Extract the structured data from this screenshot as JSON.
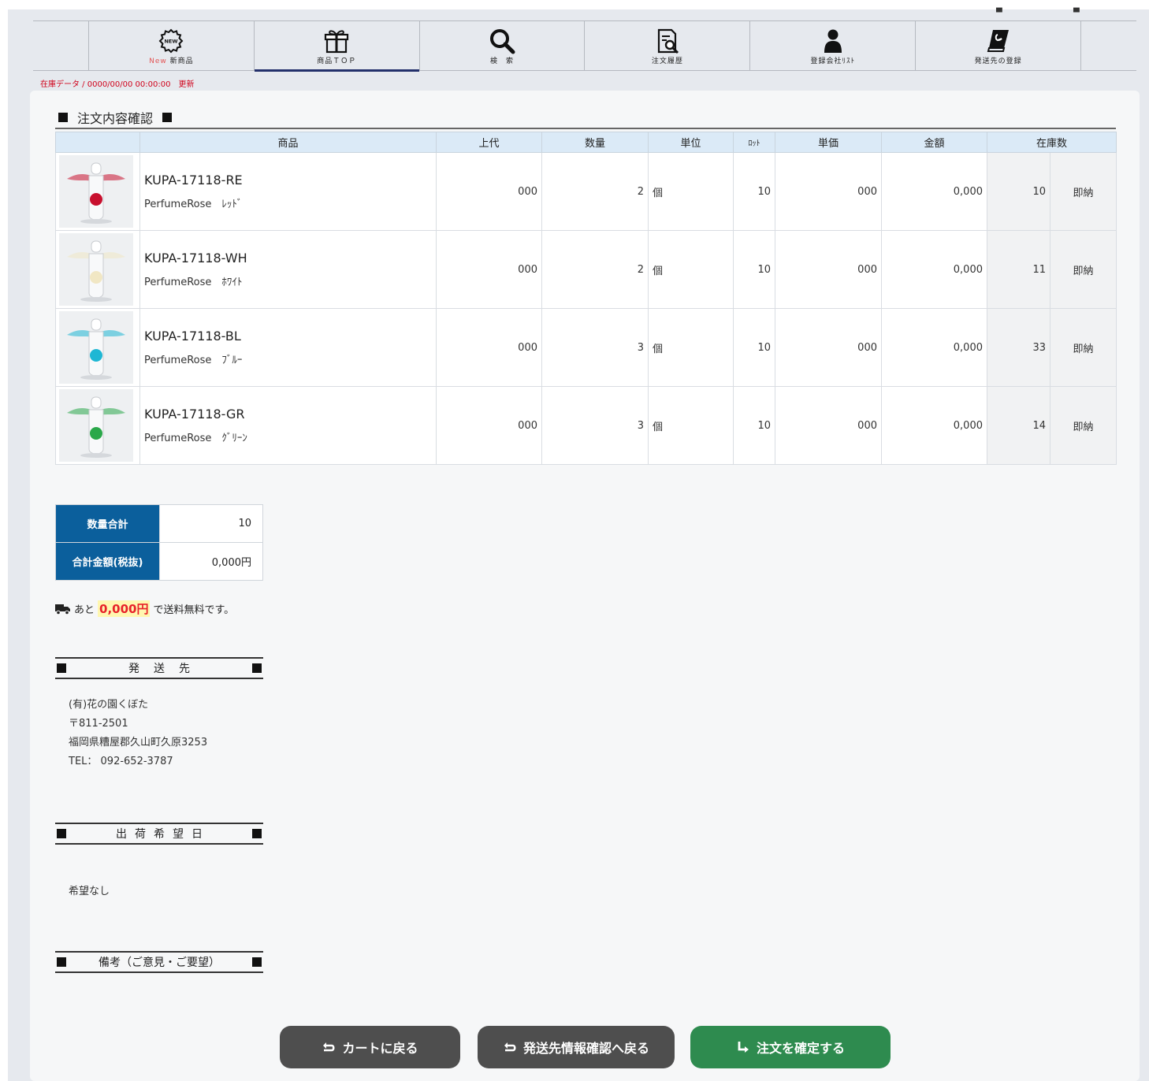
{
  "nav": {
    "items": [
      {
        "label_prefix": "New ",
        "label": "新商品",
        "icon": "new-badge-icon"
      },
      {
        "label_prefix": "",
        "label": "商品ＴＯＰ",
        "icon": "gift-icon"
      },
      {
        "label_prefix": "",
        "label": "検　索",
        "icon": "search-icon"
      },
      {
        "label_prefix": "",
        "label": "注文履歴",
        "icon": "order-history-icon"
      },
      {
        "label_prefix": "",
        "label": "登録会社ﾘｽﾄ",
        "icon": "user-icon"
      },
      {
        "label_prefix": "",
        "label": "発送先の登録",
        "icon": "book-icon"
      }
    ],
    "active_index": 1
  },
  "stock_update": "在庫データ / 0000/00/00 00:00:00　更新",
  "order": {
    "title": "注文内容確認",
    "headers": [
      "商品",
      "上代",
      "数量",
      "単位",
      "ﾛｯﾄ",
      "単価",
      "金額",
      "在庫数"
    ],
    "rows": [
      {
        "code": "KUPA-17118-RE",
        "name": "PerfumeRose　ﾚｯﾄﾞ",
        "retail": "000",
        "qty": "2",
        "unit": "個",
        "lot": "10",
        "unit_price": "000",
        "amount": "0,000",
        "stock": "10",
        "delivery": "即納",
        "color": "#c8102e"
      },
      {
        "code": "KUPA-17118-WH",
        "name": "PerfumeRose　ﾎﾜｲﾄ",
        "retail": "000",
        "qty": "2",
        "unit": "個",
        "lot": "10",
        "unit_price": "000",
        "amount": "0,000",
        "stock": "11",
        "delivery": "即納",
        "color": "#f1e7c4"
      },
      {
        "code": "KUPA-17118-BL",
        "name": "PerfumeRose　ﾌﾞﾙｰ",
        "retail": "000",
        "qty": "3",
        "unit": "個",
        "lot": "10",
        "unit_price": "000",
        "amount": "0,000",
        "stock": "33",
        "delivery": "即納",
        "color": "#1fb7d4"
      },
      {
        "code": "KUPA-17118-GR",
        "name": "PerfumeRose　ｸﾞﾘｰﾝ",
        "retail": "000",
        "qty": "3",
        "unit": "個",
        "lot": "10",
        "unit_price": "000",
        "amount": "0,000",
        "stock": "14",
        "delivery": "即納",
        "color": "#2aa84a"
      }
    ]
  },
  "totals": {
    "qty_label": "数量合計",
    "qty_value": "10",
    "amount_label": "合計金額(税抜)",
    "amount_value": "0,000円"
  },
  "ship_note": {
    "before": "あと",
    "amount": "0,000円",
    "after": "で送料無料です。"
  },
  "destination": {
    "title": "発送先",
    "lines": [
      "(有)花の園くぼた",
      "〒811-2501",
      "福岡県糟屋郡久山町久原3253",
      "TEL： 092-652-3787"
    ]
  },
  "ship_date": {
    "title": "出荷希望日",
    "value": "希望なし"
  },
  "remarks": {
    "title": "備考（ご意見・ご要望）"
  },
  "buttons": {
    "back_cart": "カートに戻る",
    "back_ship": "発送先情報確認へ戻る",
    "confirm": "注文を確定する"
  }
}
